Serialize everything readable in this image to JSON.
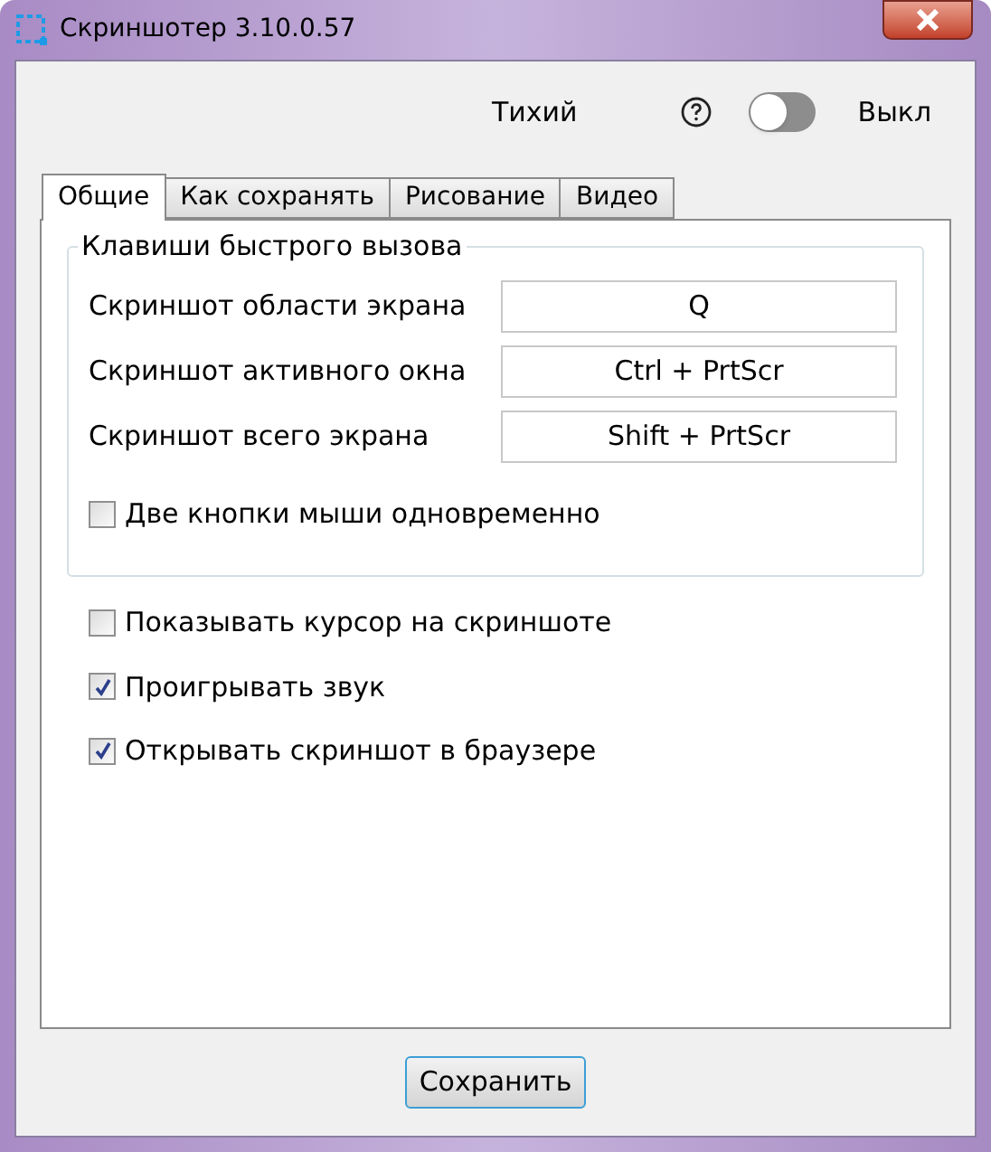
{
  "window": {
    "title": "Скриншотер 3.10.0.57"
  },
  "silent_mode": {
    "label": "Тихий",
    "on": false,
    "state_label": "Выкл"
  },
  "tabs": [
    {
      "label": "Общие",
      "selected": true
    },
    {
      "label": "Как сохранять",
      "selected": false
    },
    {
      "label": "Рисование",
      "selected": false
    },
    {
      "label": "Видео",
      "selected": false
    }
  ],
  "hotkeys": {
    "title": "Клавиши быстрого вызова",
    "rows": [
      {
        "label": "Скриншот области экрана",
        "value": "Q"
      },
      {
        "label": "Скриншот активного окна",
        "value": "Ctrl + PrtScr"
      },
      {
        "label": "Скриншот всего экрана",
        "value": "Shift + PrtScr"
      }
    ],
    "mouse_option": {
      "label": "Две кнопки мыши одновременно",
      "checked": false
    }
  },
  "options": [
    {
      "label": "Показывать курсор на скриншоте",
      "checked": false
    },
    {
      "label": "Проигрывать звук",
      "checked": true
    },
    {
      "label": "Открывать скриншот в браузере",
      "checked": true
    }
  ],
  "save_button": "Сохранить"
}
